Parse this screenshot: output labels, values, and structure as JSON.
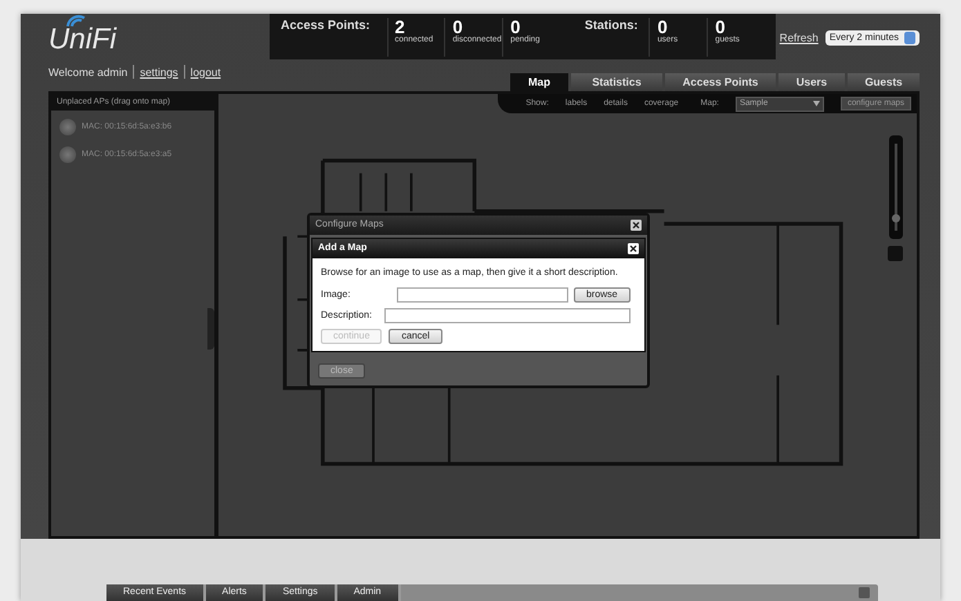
{
  "header": {
    "logo": "UniFi",
    "access_points": {
      "label": "Access Points:",
      "items": [
        {
          "value": "2",
          "label": "connected"
        },
        {
          "value": "0",
          "label": "disconnected"
        },
        {
          "value": "0",
          "label": "pending"
        }
      ]
    },
    "stations": {
      "label": "Stations:",
      "items": [
        {
          "value": "0",
          "label": "users"
        },
        {
          "value": "0",
          "label": "guests"
        }
      ]
    },
    "refresh": {
      "link": "Refresh",
      "value": "Every 2 minutes"
    }
  },
  "user_bar": {
    "welcome": "Welcome admin",
    "links": [
      "settings",
      "logout"
    ]
  },
  "tabs": [
    {
      "label": "Map",
      "selected": true
    },
    {
      "label": "Statistics",
      "selected": false
    },
    {
      "label": "Access Points",
      "selected": false
    },
    {
      "label": "Users",
      "selected": false
    },
    {
      "label": "Guests",
      "selected": false
    }
  ],
  "sidebar": {
    "title": "Unplaced APs (drag onto map)",
    "items": [
      "MAC: 00:15:6d:5a:e3:b6",
      "MAC: 00:15:6d:5a:e3:a5"
    ]
  },
  "map_toolbar": {
    "show_label": "Show:",
    "options": [
      "labels",
      "details",
      "coverage"
    ],
    "map_label": "Map:",
    "map_value": "Sample",
    "configure_button": "configure maps"
  },
  "zoom": {
    "level": 0.1
  },
  "configure_dialog": {
    "title": "Configure Maps",
    "close_button": "close"
  },
  "add_dialog": {
    "title": "Add a Map",
    "text": "Browse for an image to use as a map, then give it a short description.",
    "fields": [
      {
        "label": "Image:",
        "button": "browse"
      },
      {
        "label": "Description:"
      }
    ],
    "buttons": [
      {
        "label": "continue",
        "disabled": true
      },
      {
        "label": "cancel",
        "disabled": false
      }
    ]
  },
  "bottom_tabs": [
    {
      "label": "Recent Events",
      "selected": false
    },
    {
      "label": "Alerts",
      "selected": false
    },
    {
      "label": "Settings",
      "selected": false
    },
    {
      "label": "Admin",
      "selected": false
    }
  ]
}
